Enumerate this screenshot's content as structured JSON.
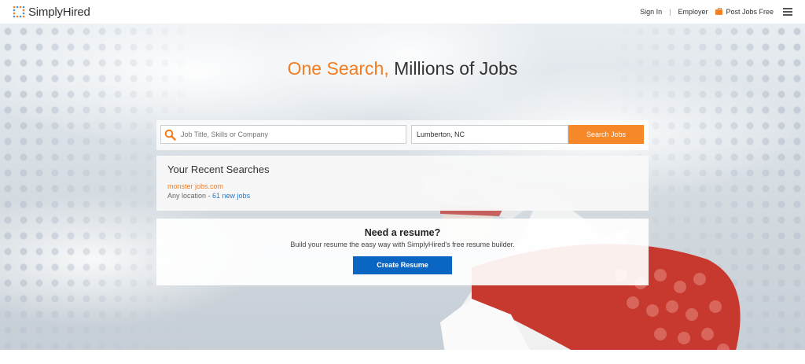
{
  "header": {
    "logo_text": "SimplyHired",
    "nav": {
      "sign_in": "Sign In",
      "employer": "Employer",
      "post_jobs": "Post Jobs Free"
    },
    "icons": [
      "logo-dots-icon",
      "briefcase-icon",
      "hamburger-menu-icon"
    ]
  },
  "hero": {
    "tagline_accent": "One Search,",
    "tagline_rest": " Millions of Jobs"
  },
  "search": {
    "what_placeholder": "Job Title, Skills or Company",
    "what_value": "",
    "where_value": "Lumberton, NC",
    "button_label": "Search Jobs"
  },
  "recent_searches": {
    "title": "Your Recent Searches",
    "items": [
      {
        "query": "monster jobs.com",
        "location": "Any location - ",
        "new_jobs": "61 new jobs"
      }
    ]
  },
  "resume": {
    "title": "Need a resume?",
    "subtitle": "Build your resume the easy way with SimplyHired's free resume builder.",
    "button_label": "Create Resume"
  },
  "colors": {
    "accent_orange": "#f47c20",
    "search_button": "#f6882a",
    "primary_blue": "#0b66c3",
    "link_blue": "#2a77c9"
  }
}
